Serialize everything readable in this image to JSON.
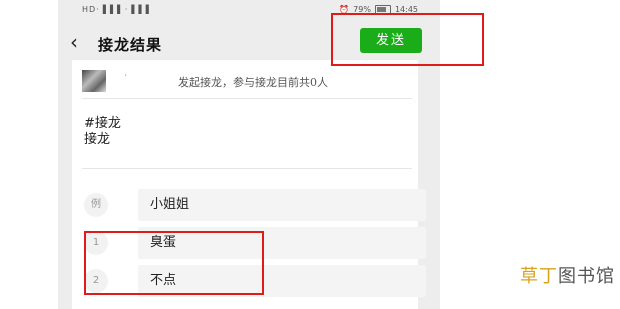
{
  "status_bar": {
    "left": "HD·▐▐▐ ·▐▐▐",
    "battery_text": "79%",
    "time": "14:45"
  },
  "nav": {
    "back_icon": "‹",
    "title": "接龙结果",
    "send_label": "发送"
  },
  "header": {
    "initiator_name": "’",
    "info": "发起接龙，参与接龙目前共0人"
  },
  "topic": {
    "line1": "#接龙",
    "line2": "接龙"
  },
  "entries": [
    {
      "index": "例",
      "text": "小姐姐"
    },
    {
      "index": "1",
      "text": "臭蛋"
    },
    {
      "index": "2",
      "text": "不点"
    }
  ],
  "watermark": {
    "part1": "草丁",
    "part2": "图书馆"
  },
  "colors": {
    "send_button": "#1aad19",
    "annotation": "#e01b1b"
  }
}
